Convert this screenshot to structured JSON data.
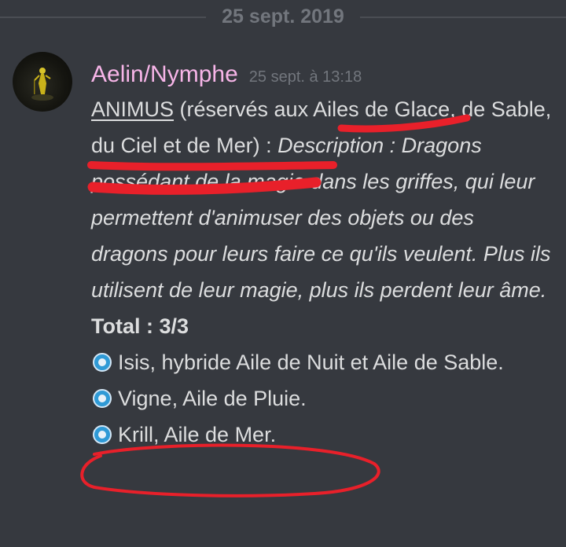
{
  "divider": {
    "date": "25 sept. 2019"
  },
  "message": {
    "author": "Aelin/Nymphe",
    "timestamp": "25 sept. à 13:18",
    "intro": {
      "term": "ANIMUS",
      "open_paren": " (réservés aux ",
      "highlight": "Ailes de Glace",
      "rest": ", de Sable, du Ciel et de Mer) : ",
      "description": "Description : Dragons possédant de la magie dans les griffes, qui leur permettent d'animuser des objets ou des dragons pour leurs faire ce qu'ils veulent. Plus ils utilisent de leur magie, plus ils perdent leur âme."
    },
    "total": "Total : 3/3",
    "items": [
      "Isis, hybride Aile de Nuit et Aile de Sable.",
      "Vigne, Aile de Pluie.",
      "Krill, Aile de Mer."
    ]
  },
  "colors": {
    "background": "#36393f",
    "username": "#f7b5e8",
    "text": "#dcddde",
    "muted": "#72767d",
    "annotation": "#e8202a",
    "bullet": "#2f9ad6"
  }
}
